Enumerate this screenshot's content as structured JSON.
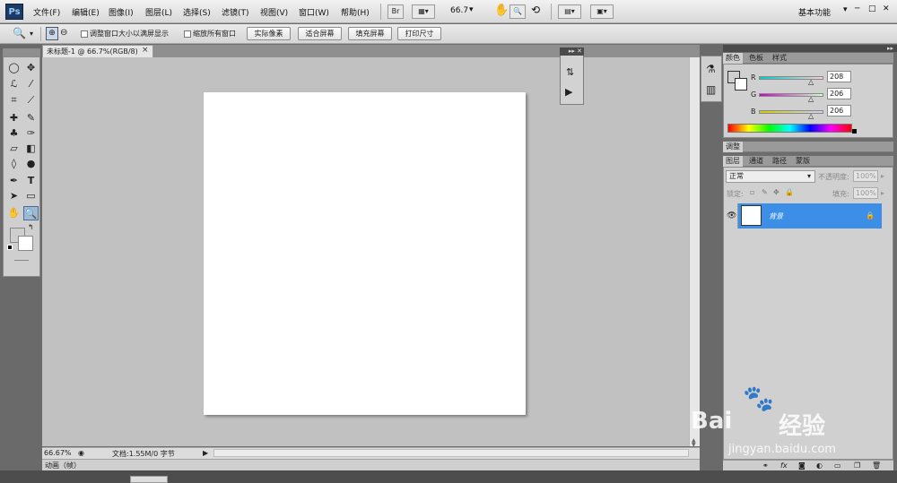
{
  "menubar": {
    "logo": "Ps",
    "items": [
      "文件(F)",
      "编辑(E)",
      "图像(I)",
      "图层(L)",
      "选择(S)",
      "滤镜(T)",
      "视图(V)",
      "窗口(W)",
      "帮助(H)"
    ],
    "bridge_label": "Br",
    "zoom_value": "66.7",
    "workspace": "基本功能",
    "win_min": "─",
    "win_max": "□",
    "win_close": "✕"
  },
  "options": {
    "checkbox1_label": "调整窗口大小以满屏显示",
    "checkbox2_label": "缩放所有窗口",
    "btn_actual": "实际像素",
    "btn_fit": "适合屏幕",
    "btn_fill": "填充屏幕",
    "btn_print": "打印尺寸"
  },
  "document": {
    "tab_title": "未标题-1 @ 66.7%(RGB/8)",
    "close": "×",
    "zoom_status": "66.67%",
    "doc_info": "文档:1.55M/0 字节",
    "animation_label": "动画（帧）"
  },
  "color_panel": {
    "tabs": [
      "颜色",
      "色板",
      "样式"
    ],
    "r_label": "R",
    "g_label": "G",
    "b_label": "B",
    "r_value": "208",
    "g_value": "206",
    "b_value": "206",
    "accent": "#3d8ee6"
  },
  "adjust_panel": {
    "tabs": [
      "调整"
    ]
  },
  "layers_panel": {
    "tabs": [
      "图层",
      "通道",
      "路径",
      "蒙版"
    ],
    "blend_mode": "正常",
    "opacity_label": "不透明度:",
    "opacity_value": "100%",
    "lock_label": "锁定:",
    "fill_label": "填充:",
    "fill_value": "100%",
    "layer_name": "背景"
  },
  "watermark": {
    "brand": "Bai",
    "brand_cn": "经验",
    "url": "jingyan.baidu.com"
  }
}
